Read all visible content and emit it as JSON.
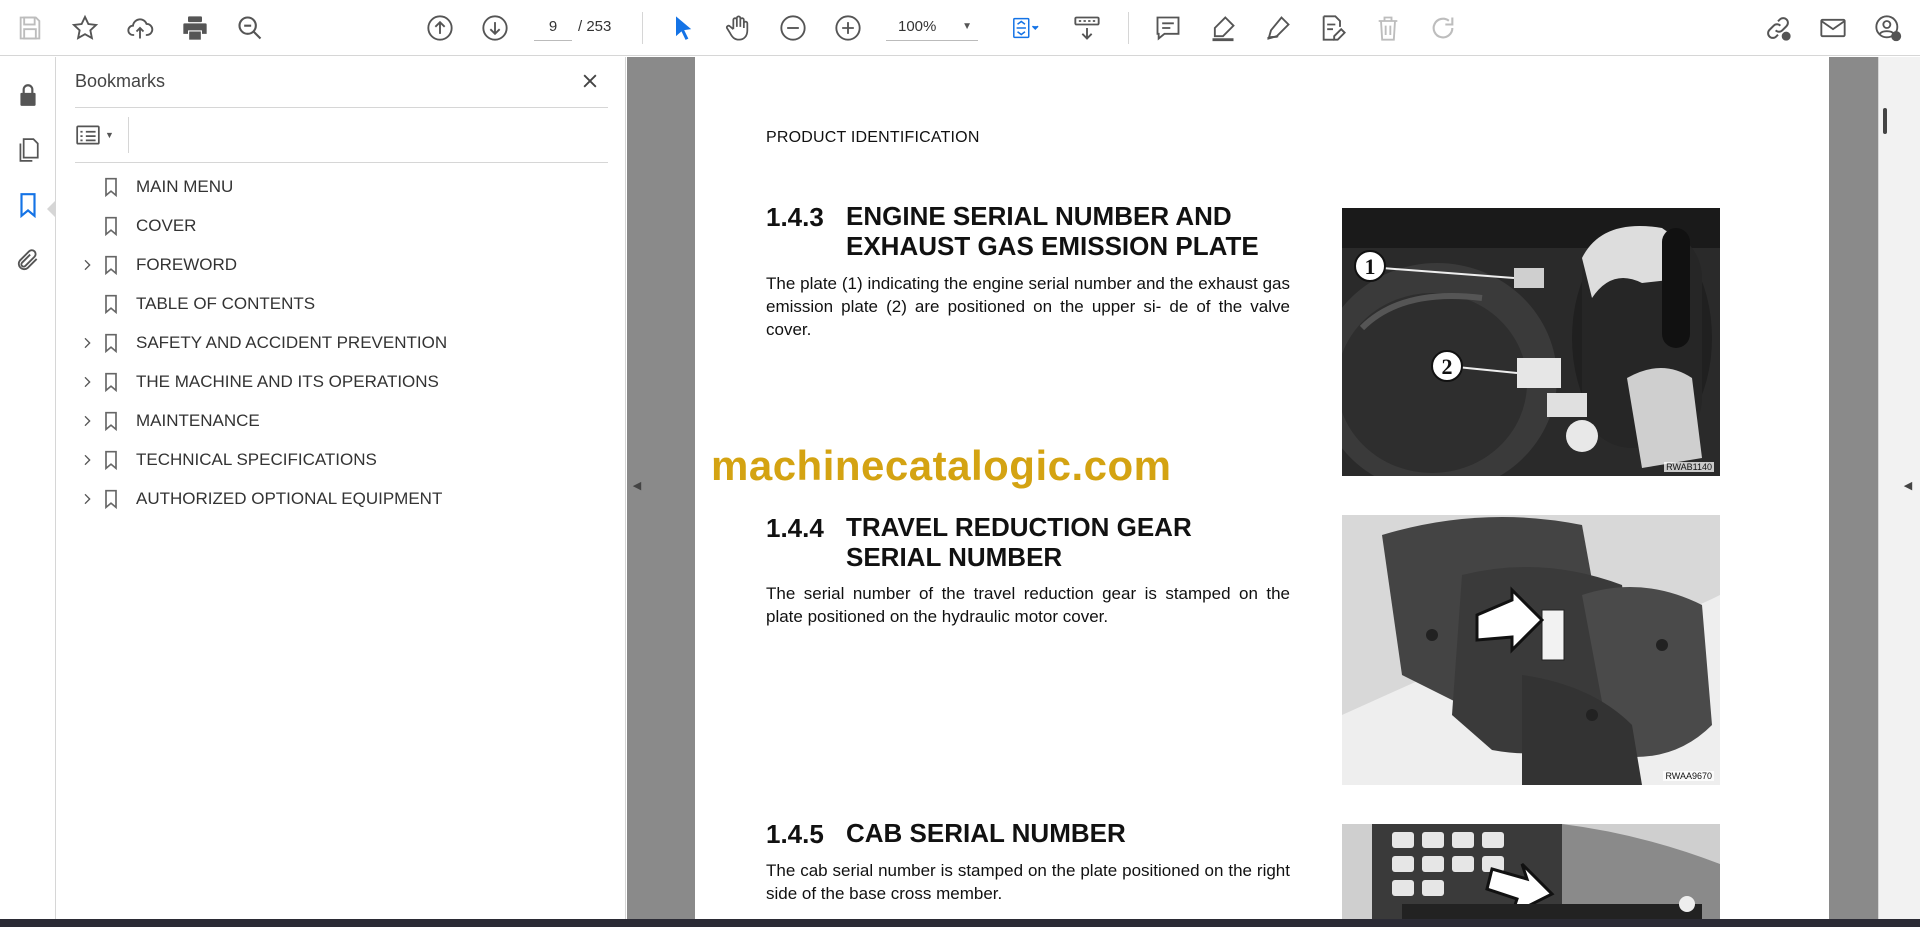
{
  "toolbar": {
    "page_current": "9",
    "page_total": "/ 253",
    "zoom": "100%",
    "icons": [
      "save-icon",
      "bookmark-star-icon",
      "upload-cloud-icon",
      "print-icon",
      "find-zoom-icon",
      "prev-page-icon",
      "next-page-icon",
      "select-cursor-icon",
      "hand-tool-icon",
      "zoom-out-icon",
      "zoom-in-icon",
      "fit-page-icon",
      "scroll-mode-icon",
      "comment-icon",
      "highlight-icon",
      "draw-icon",
      "fill-sign-icon",
      "delete-icon",
      "redo-icon",
      "share-link-icon",
      "email-icon",
      "account-icon"
    ]
  },
  "rail": {
    "icons": [
      "lock-icon",
      "pages-icon",
      "bookmark-icon",
      "attachment-icon"
    ]
  },
  "bookmarks_panel": {
    "title": "Bookmarks",
    "items": [
      {
        "label": "MAIN MENU",
        "expandable": false
      },
      {
        "label": "COVER",
        "expandable": false
      },
      {
        "label": "FOREWORD",
        "expandable": true
      },
      {
        "label": "TABLE OF CONTENTS",
        "expandable": false
      },
      {
        "label": "SAFETY AND ACCIDENT PREVENTION",
        "expandable": true
      },
      {
        "label": "THE MACHINE AND ITS OPERATIONS",
        "expandable": true
      },
      {
        "label": "MAINTENANCE",
        "expandable": true
      },
      {
        "label": "TECHNICAL SPECIFICATIONS",
        "expandable": true
      },
      {
        "label": "AUTHORIZED OPTIONAL EQUIPMENT",
        "expandable": true
      }
    ]
  },
  "document": {
    "header": "PRODUCT IDENTIFICATION",
    "watermark": "machinecatalogic.com",
    "sections": [
      {
        "number": "1.4.3",
        "title_line1": "ENGINE SERIAL NUMBER AND",
        "title_line2": "EXHAUST GAS EMISSION PLATE",
        "body": "The plate (1) indicating the engine serial number and the exhaust gas emission plate (2) are positioned on the upper si- de of the valve cover.",
        "figure_code": "RWAB1140",
        "callouts": [
          "1",
          "2"
        ]
      },
      {
        "number": "1.4.4",
        "title_line1": "TRAVEL REDUCTION GEAR",
        "title_line2": "SERIAL NUMBER",
        "body": "The serial number of the travel reduction gear is stamped on the plate positioned on the hydraulic motor cover.",
        "figure_code": "RWAA9670"
      },
      {
        "number": "1.4.5",
        "title_line1": "CAB SERIAL NUMBER",
        "body": "The cab serial number is stamped on the plate positioned on the right side of the base cross member."
      }
    ]
  },
  "colors": {
    "accent": "#1473e6",
    "watermark": "#d4a312",
    "viewer_bg": "#8a8a8a"
  }
}
